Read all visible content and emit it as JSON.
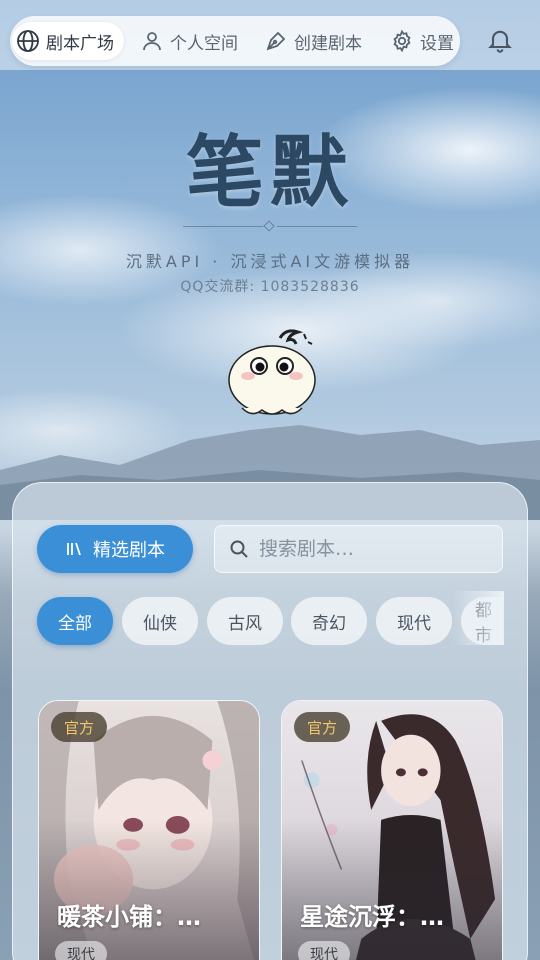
{
  "nav": {
    "items": [
      {
        "label": "剧本广场",
        "icon": "globe-icon",
        "active": true
      },
      {
        "label": "个人空间",
        "icon": "user-icon",
        "active": false
      },
      {
        "label": "创建剧本",
        "icon": "pen-nib-icon",
        "active": false
      },
      {
        "label": "设置",
        "icon": "gear-icon",
        "active": false
      }
    ],
    "notification_icon": "bell-icon"
  },
  "hero": {
    "title": "笔默",
    "subtitle": "沉默API · 沉浸式AI文游模拟器",
    "qq": "QQ交流群: 1083528836"
  },
  "panel": {
    "featured_label": "精选剧本",
    "search_placeholder": "搜索剧本…",
    "categories": [
      "全部",
      "仙侠",
      "古风",
      "奇幻",
      "现代",
      "都市"
    ],
    "active_category": "全部"
  },
  "cards": [
    {
      "badge": "官方",
      "title": "暖茶小铺：…",
      "tag": "现代"
    },
    {
      "badge": "官方",
      "title": "星途沉浮：…",
      "tag": "现代"
    }
  ],
  "colors": {
    "accent": "#3a8fd6",
    "title": "#2c4863",
    "badge_text": "#f3c76a"
  }
}
